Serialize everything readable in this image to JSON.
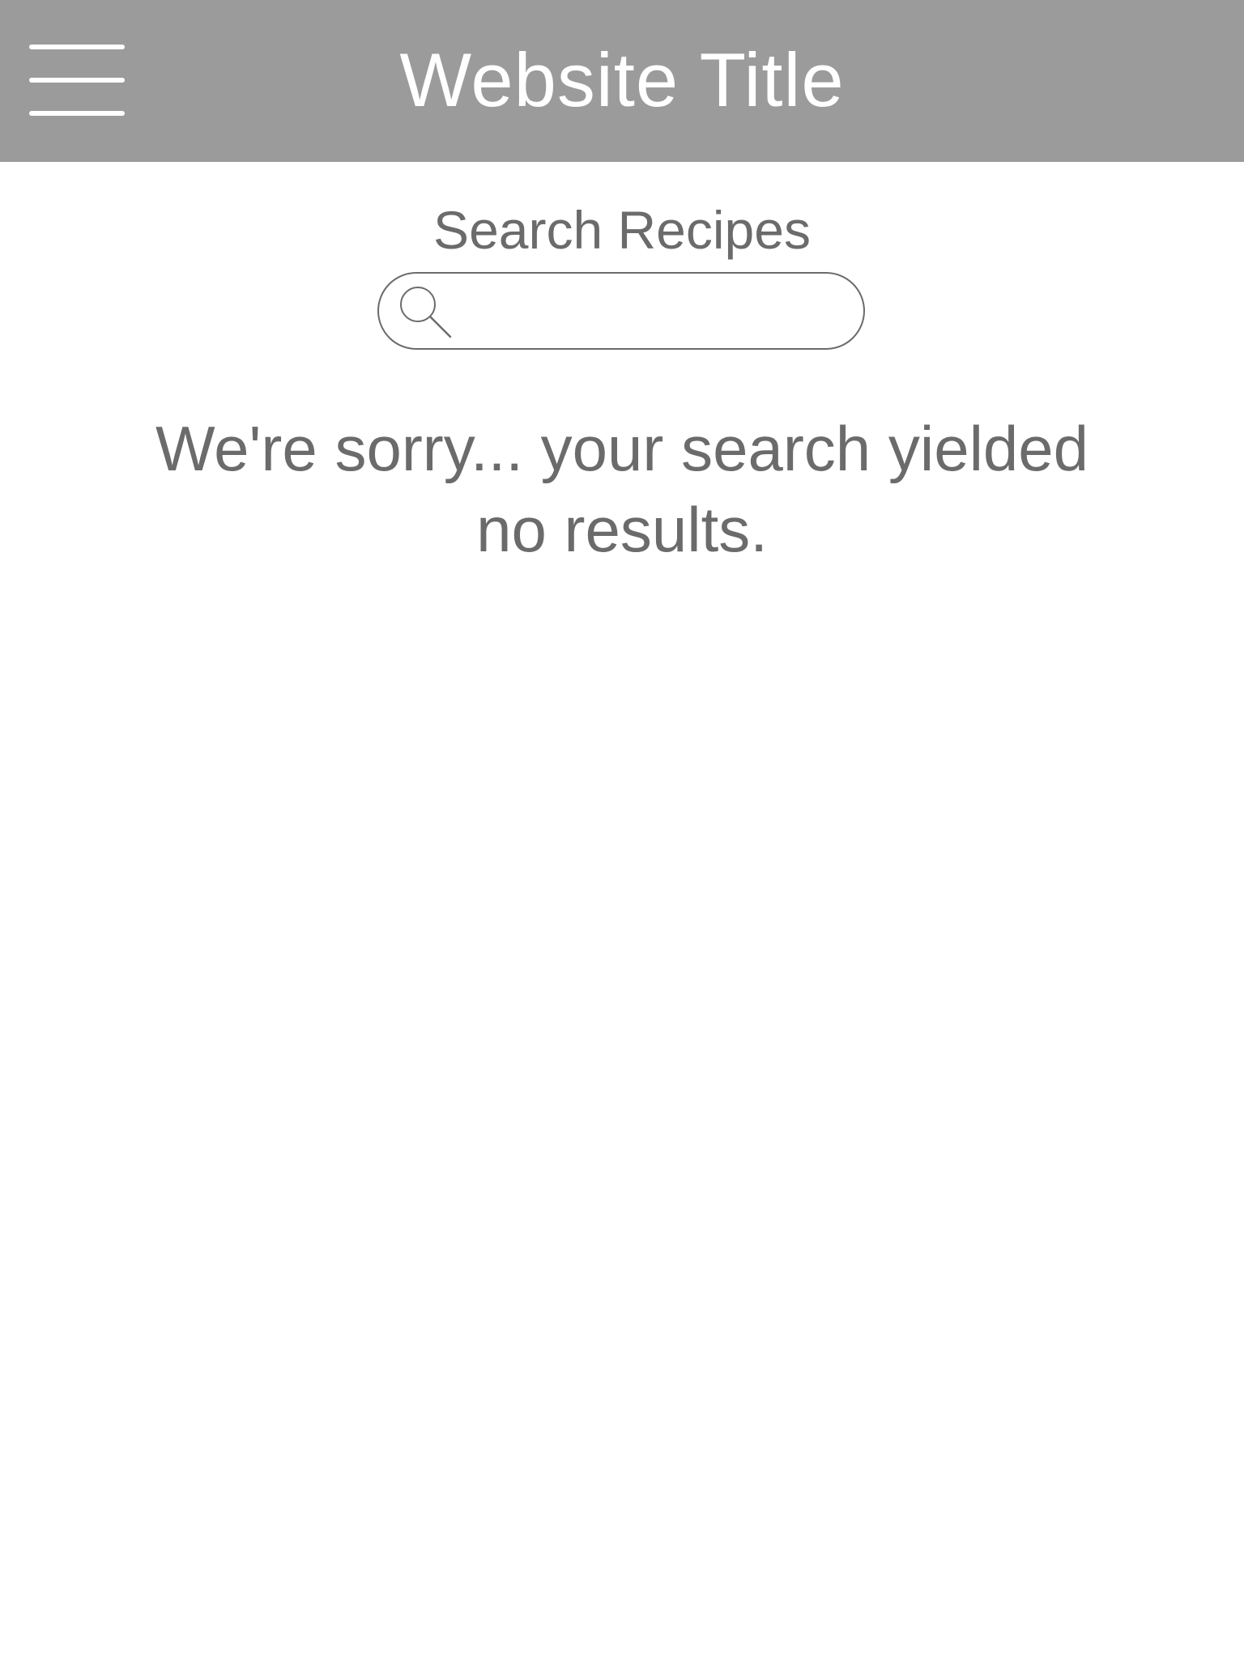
{
  "header": {
    "title": "Website Title",
    "menu_icon": "hamburger-menu-icon",
    "background_color": "#9b9b9b"
  },
  "search": {
    "label": "Search Recipes",
    "placeholder": "",
    "value": "",
    "icon": "search-icon"
  },
  "results": {
    "message": "We're sorry... your search yielded no results."
  }
}
